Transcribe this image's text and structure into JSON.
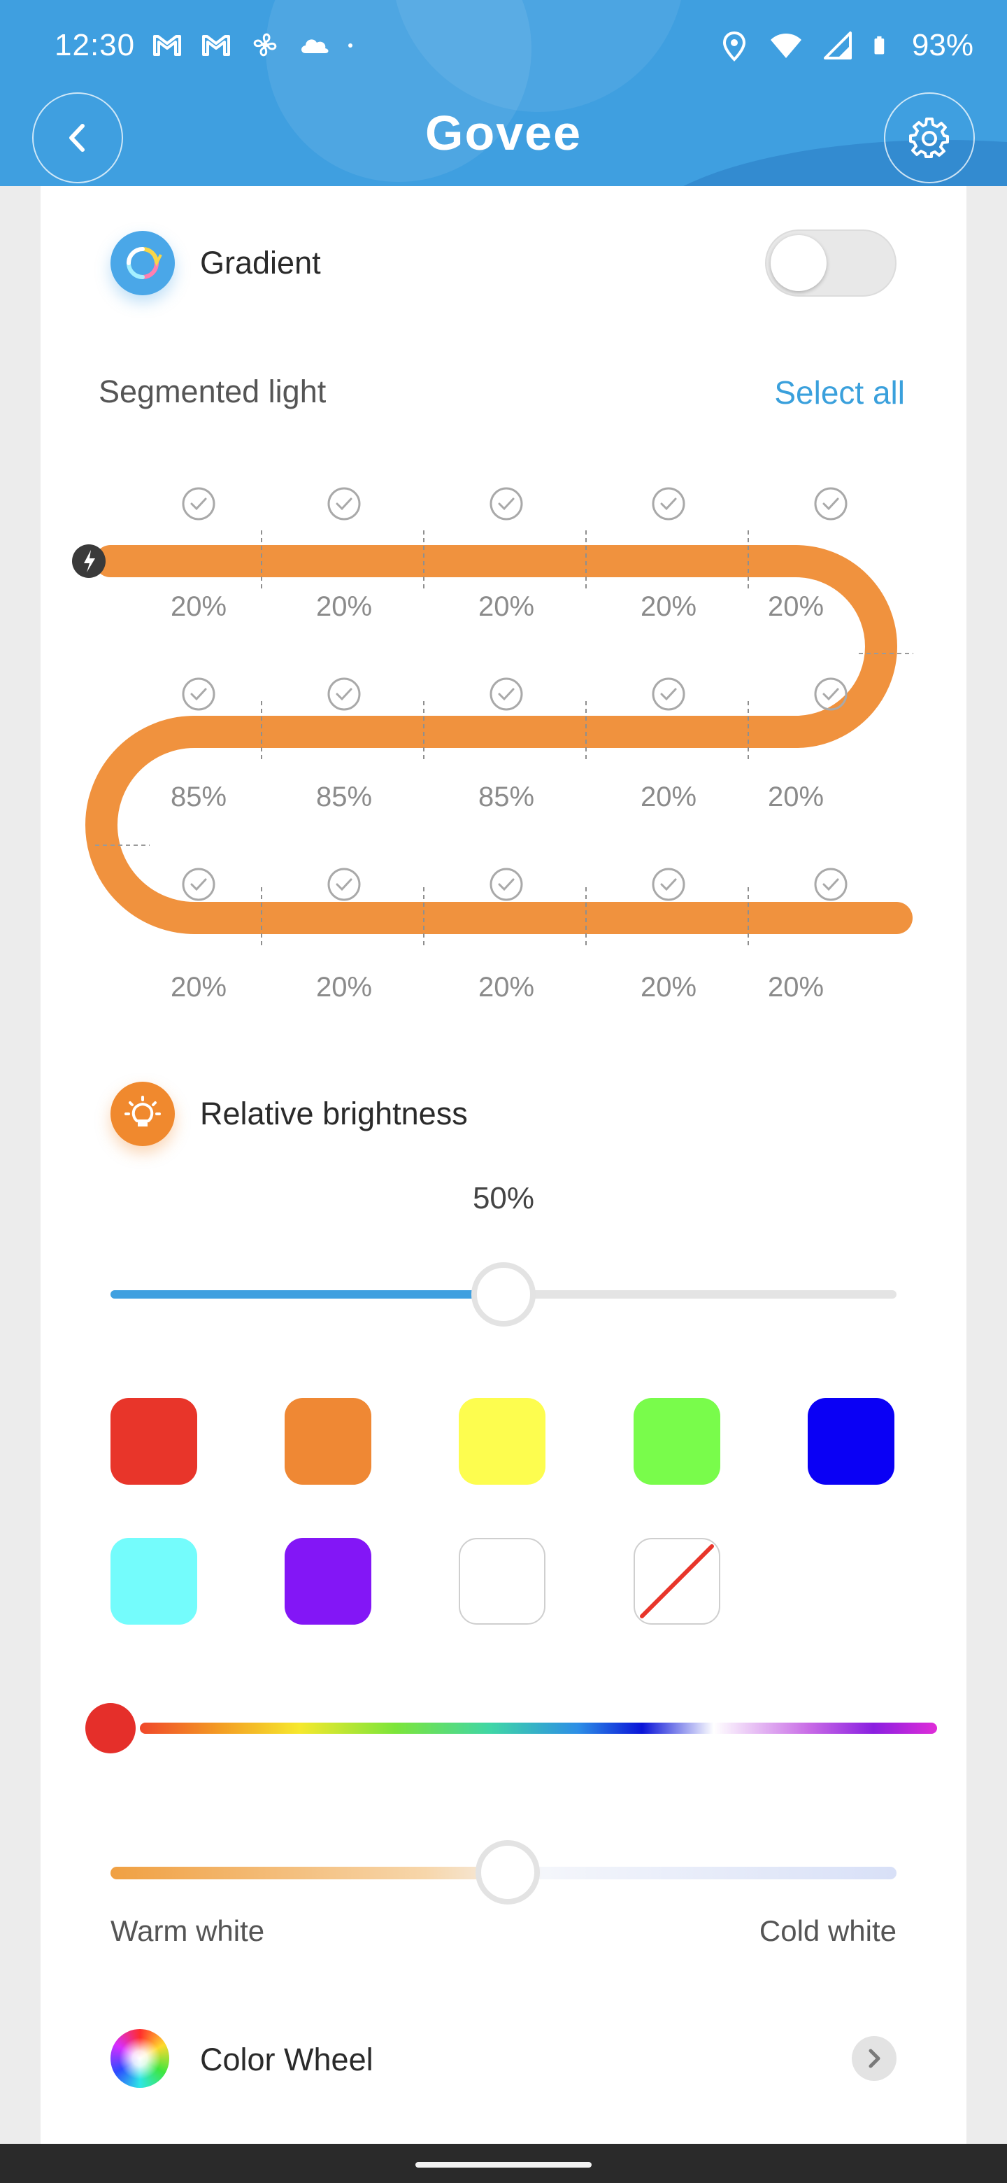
{
  "status_bar": {
    "time": "12:30",
    "battery": "93%",
    "left_icons": [
      "gmail-icon",
      "gmail-icon",
      "fan-icon",
      "cloud-icon",
      "dot-icon"
    ],
    "right_icons": [
      "location-icon",
      "wifi-icon",
      "signal-icon",
      "battery-icon"
    ]
  },
  "header": {
    "title": "Govee",
    "background_color": "#3f9fe0"
  },
  "gradient": {
    "label": "Gradient",
    "enabled": false
  },
  "segments": {
    "title": "Segmented light",
    "select_all": "Select all",
    "strip_color": "#f0923e",
    "rows": [
      {
        "values": [
          "20%",
          "20%",
          "20%",
          "20%",
          "20%"
        ]
      },
      {
        "values": [
          "85%",
          "85%",
          "85%",
          "20%",
          "20%"
        ]
      },
      {
        "values": [
          "20%",
          "20%",
          "20%",
          "20%",
          "20%"
        ]
      }
    ]
  },
  "brightness": {
    "label": "Relative brightness",
    "value": "50%",
    "level": 0.5
  },
  "colors": {
    "presets": [
      "#e8352a",
      "#ef8834",
      "#fdfd4f",
      "#79fc4b",
      "#0a00f5",
      "#74fcfc",
      "#8316f6",
      "#ffffff"
    ],
    "none_label": "no-color",
    "hue_position": 0.0
  },
  "white_temperature": {
    "warm_label": "Warm white",
    "cold_label": "Cold white",
    "level": 0.5
  },
  "color_wheel": {
    "label": "Color Wheel"
  }
}
